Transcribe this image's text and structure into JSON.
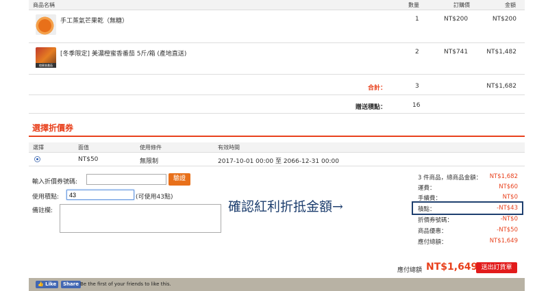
{
  "table": {
    "headers": {
      "name": "商品名稱",
      "qty": "數量",
      "price": "訂購價",
      "amount": "金額"
    },
    "items": [
      {
        "name": "手工蒸氣芒果乾（無糖）",
        "qty": "1",
        "price": "NT$200",
        "amount": "NT$200",
        "thumb_tag": ""
      },
      {
        "name": "[冬季限定] 美濃橙蜜香番茄 5斤/箱 (產地直送)",
        "qty": "2",
        "price": "NT$741",
        "amount": "NT$1,482",
        "thumb_tag": "橙蜜香番茄"
      }
    ],
    "subtotal": {
      "label": "合計：",
      "qty": "3",
      "amount": "NT$1,682"
    },
    "bonus": {
      "label": "贈送積點：",
      "value": "16"
    }
  },
  "coupon": {
    "title": "選擇折價券",
    "headers": {
      "select": "選擇",
      "value": "面值",
      "condition": "使用條件",
      "period": "有效時間"
    },
    "rows": [
      {
        "value": "NT$50",
        "condition": "無限制",
        "period": "2017-10-01 00:00 至 2066-12-31 00:00"
      }
    ]
  },
  "form": {
    "code_label": "輸入折價券號碼:",
    "verify_label": "驗證",
    "points_label": "使用積點:",
    "points_value": "43",
    "points_hint": "(可使用43點)",
    "notes_label": "備註欄:"
  },
  "summary": {
    "rows": [
      {
        "label": "3 件商品，總商品金額：",
        "value": "NT$1,682"
      },
      {
        "label": "運費：",
        "value": "NT$60"
      },
      {
        "label": "手續費：",
        "value": "NT$0"
      },
      {
        "label": "積點：",
        "value": "-NT$43"
      },
      {
        "label": "折價券號碼：",
        "value": "-NT$0"
      },
      {
        "label": "商品優惠：",
        "value": "-NT$50"
      },
      {
        "label": "應付總額：",
        "value": "NT$1,649"
      }
    ],
    "total_label": "應付總額",
    "total_value": "NT$1,649",
    "order_label": "送出訂貨單"
  },
  "annotation": "確認紅利折抵金額→",
  "facebook": {
    "like": "Like",
    "share": "Share",
    "text": "Be the first of your friends to like this."
  },
  "colors": {
    "accent": "#e8401c",
    "annotation": "#1d3e6e",
    "fb": "#4267b2"
  }
}
